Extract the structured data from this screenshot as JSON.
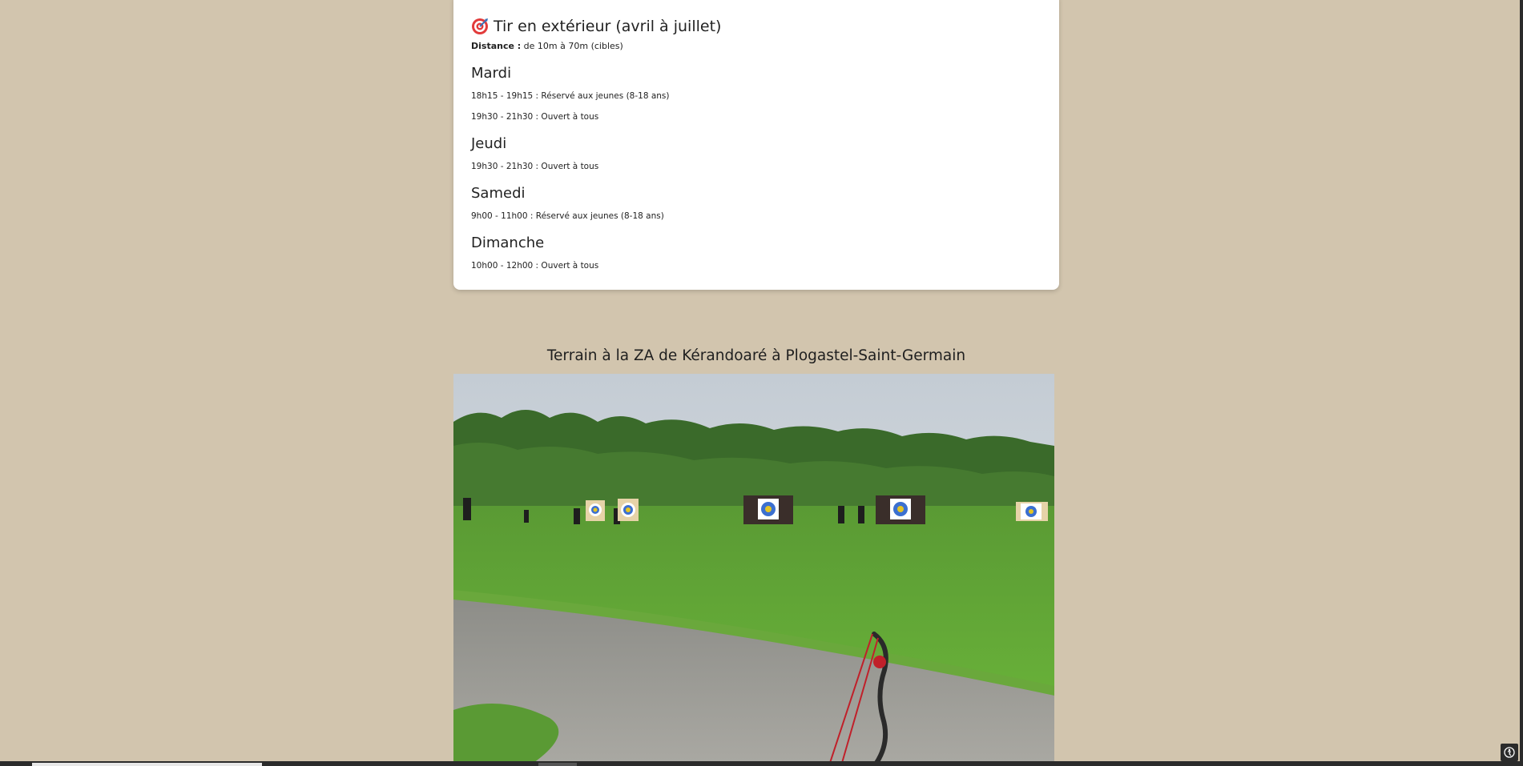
{
  "card": {
    "title": "Tir en extérieur (avril à juillet)",
    "title_icon": "target-icon",
    "distance_label": "Distance :",
    "distance_value": " de 10m à 70m (cibles)",
    "days": [
      {
        "name": "Mardi",
        "slots": [
          {
            "time": "18h15 - 19h15 :",
            "desc": " Réservé aux jeunes (8-18 ans)"
          },
          {
            "time": "19h30 - 21h30 :",
            "desc": " Ouvert à tous"
          }
        ]
      },
      {
        "name": "Jeudi",
        "slots": [
          {
            "time": "19h30 - 21h30 :",
            "desc": " Ouvert à tous"
          }
        ]
      },
      {
        "name": "Samedi",
        "slots": [
          {
            "time": "9h00 - 11h00 :",
            "desc": " Réservé aux jeunes (8-18 ans)"
          }
        ]
      },
      {
        "name": "Dimanche",
        "slots": [
          {
            "time": "10h00 - 12h00 :",
            "desc": " Ouvert à tous"
          }
        ]
      }
    ]
  },
  "terrain": {
    "title": "Terrain à la ZA de Kérandoaré à Plogastel-Saint-Germain"
  },
  "colors": {
    "background": "#d2c5ae",
    "card": "#ffffff",
    "grass": "#5fa832",
    "sky": "#cfd6dc",
    "trees": "#3d6b2a",
    "path": "#9a9a94"
  }
}
